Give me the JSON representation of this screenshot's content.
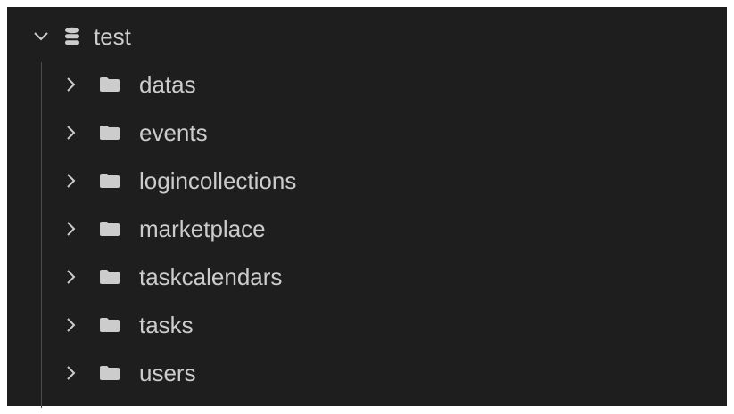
{
  "tree": {
    "root": {
      "label": "test",
      "icon": "database-icon",
      "expanded": true
    },
    "collections": [
      {
        "label": "datas",
        "icon": "folder-icon",
        "expanded": false
      },
      {
        "label": "events",
        "icon": "folder-icon",
        "expanded": false
      },
      {
        "label": "logincollections",
        "icon": "folder-icon",
        "expanded": false
      },
      {
        "label": "marketplace",
        "icon": "folder-icon",
        "expanded": false
      },
      {
        "label": "taskcalendars",
        "icon": "folder-icon",
        "expanded": false
      },
      {
        "label": "tasks",
        "icon": "folder-icon",
        "expanded": false
      },
      {
        "label": "users",
        "icon": "folder-icon",
        "expanded": false
      }
    ]
  },
  "colors": {
    "background": "#1e1e1e",
    "text": "#cccccc",
    "icon": "#cccccc",
    "guide": "#4b4b4b"
  }
}
